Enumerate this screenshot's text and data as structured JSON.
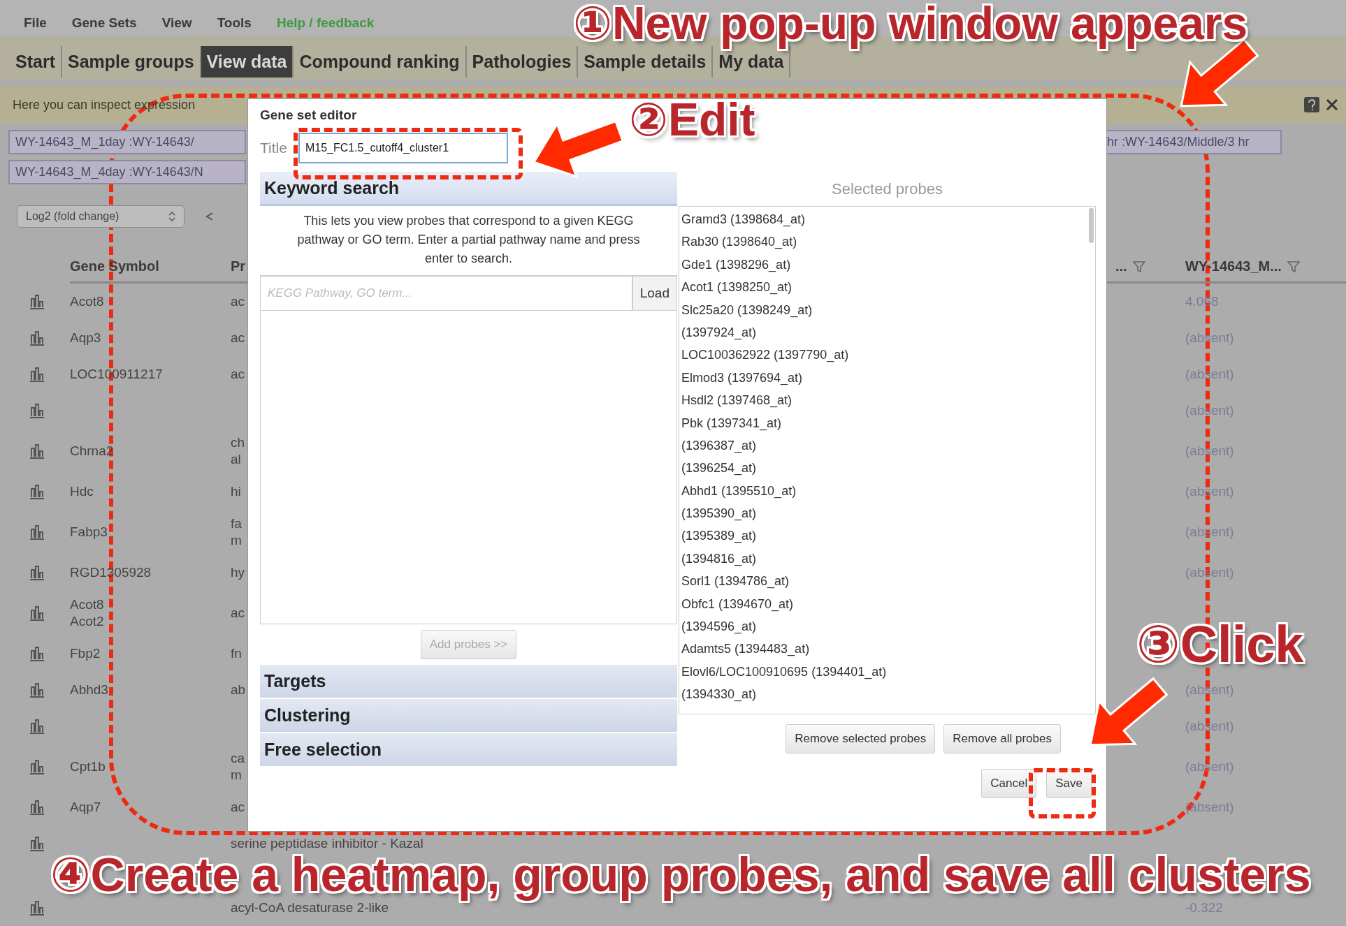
{
  "menu": [
    {
      "label": "File",
      "kind": "plain"
    },
    {
      "label": "Gene Sets",
      "kind": "plain"
    },
    {
      "label": "View",
      "kind": "plain"
    },
    {
      "label": "Tools",
      "kind": "plain"
    },
    {
      "label": "Help / feedback",
      "kind": "help"
    }
  ],
  "tabs": [
    {
      "label": "Start",
      "selected": false
    },
    {
      "label": "Sample groups",
      "selected": false
    },
    {
      "label": "View data",
      "selected": true
    },
    {
      "label": "Compound ranking",
      "selected": false
    },
    {
      "label": "Pathologies",
      "selected": false
    },
    {
      "label": "Sample details",
      "selected": false
    },
    {
      "label": "My data",
      "selected": false
    }
  ],
  "info_bar": {
    "text": "Here you can inspect expression"
  },
  "sample_groups": {
    "left": [
      "WY-14643_M_1day :WY-14643/",
      "WY-14643_M_4day :WY-14643/N"
    ],
    "right": "hr :WY-14643/Middle/3 hr"
  },
  "value_type": {
    "value": "Log2 (fold change)"
  },
  "table": {
    "columns": [
      "Gene Symbol",
      "Pr",
      "...",
      "WY-14643_M..."
    ],
    "rows": [
      {
        "gene": [
          "Acot8"
        ],
        "product": [
          "ac"
        ],
        "value": "4.068"
      },
      {
        "gene": [
          "Aqp3"
        ],
        "product": [
          "ac"
        ],
        "value": "(absent)"
      },
      {
        "gene": [
          "LOC100911217"
        ],
        "product": [
          "ac"
        ],
        "value": "(absent)"
      },
      {
        "gene": [],
        "product": [],
        "value": "(absent)"
      },
      {
        "gene": [
          "Chrna2"
        ],
        "product": [
          "ch",
          "al"
        ],
        "value": "(absent)"
      },
      {
        "gene": [
          "Hdc"
        ],
        "product": [
          "hi"
        ],
        "value": "(absent)"
      },
      {
        "gene": [
          "Fabp3"
        ],
        "product": [
          "fa",
          "m"
        ],
        "value": "(absent)"
      },
      {
        "gene": [
          "RGD1305928"
        ],
        "product": [
          "hy"
        ],
        "value": "(absent)"
      },
      {
        "gene": [
          "Acot8",
          "Acot2"
        ],
        "product": [
          "ac"
        ]
      },
      {
        "gene": [
          "Fbp2"
        ],
        "product": [
          "fn"
        ]
      },
      {
        "gene": [
          "Abhd3"
        ],
        "product": [
          "ab"
        ],
        "value": "(absent)"
      },
      {
        "gene": [],
        "product": [],
        "value": "(absent)"
      },
      {
        "gene": [
          "Cpt1b"
        ],
        "product": [
          "ca",
          "m"
        ],
        "value": "(absent)"
      },
      {
        "gene": [
          "Aqp7"
        ],
        "product": [
          "ac"
        ],
        "value": "(absent)"
      },
      {
        "gene": [],
        "product": [
          "serine peptidase inhibitor - Kazal"
        ]
      },
      {
        "gene": [],
        "product": [
          "acyl-CoA desaturase 2-like"
        ],
        "value": "-0.322"
      }
    ]
  },
  "dialog": {
    "title": "Gene set editor",
    "title_label": "Title",
    "title_value": "M15_FC1.5_cutoff4_cluster1",
    "sections": [
      {
        "label": "Keyword search",
        "expanded": true
      },
      {
        "label": "Targets",
        "expanded": false
      },
      {
        "label": "Clustering",
        "expanded": false
      },
      {
        "label": "Free selection",
        "expanded": false
      }
    ],
    "keyword_help": "This lets you view probes that correspond to a given KEGG pathway or GO term. Enter a partial pathway name and press enter to search.",
    "search": {
      "placeholder": "KEGG Pathway, GO term..."
    },
    "load_button": "Load",
    "add_button": {
      "label": "Add probes >>",
      "disabled": true
    },
    "selected_title": "Selected probes",
    "probes": [
      "Gramd3 (1398684_at)",
      "Rab30 (1398640_at)",
      "Gde1 (1398296_at)",
      "Acot1 (1398250_at)",
      "Slc25a20 (1398249_at)",
      "(1397924_at)",
      "LOC100362922 (1397790_at)",
      "Elmod3 (1397694_at)",
      "Hsdl2 (1397468_at)",
      "Pbk (1397341_at)",
      "(1396387_at)",
      "(1396254_at)",
      "Abhd1 (1395510_at)",
      "(1395390_at)",
      "(1395389_at)",
      "(1394816_at)",
      "Sorl1 (1394786_at)",
      "Obfc1 (1394670_at)",
      "(1394596_at)",
      "Adamts5 (1394483_at)",
      "Elovl6/LOC100910695 (1394401_at)",
      "(1394330_at)"
    ],
    "buttons": [
      "Remove selected probes",
      "Remove all probes",
      "Cancel",
      "Save"
    ]
  },
  "annotations": [
    "①New pop-up window appears",
    "②Edit",
    "③Click",
    "④Create a heatmap, group probes, and save all clusters"
  ]
}
